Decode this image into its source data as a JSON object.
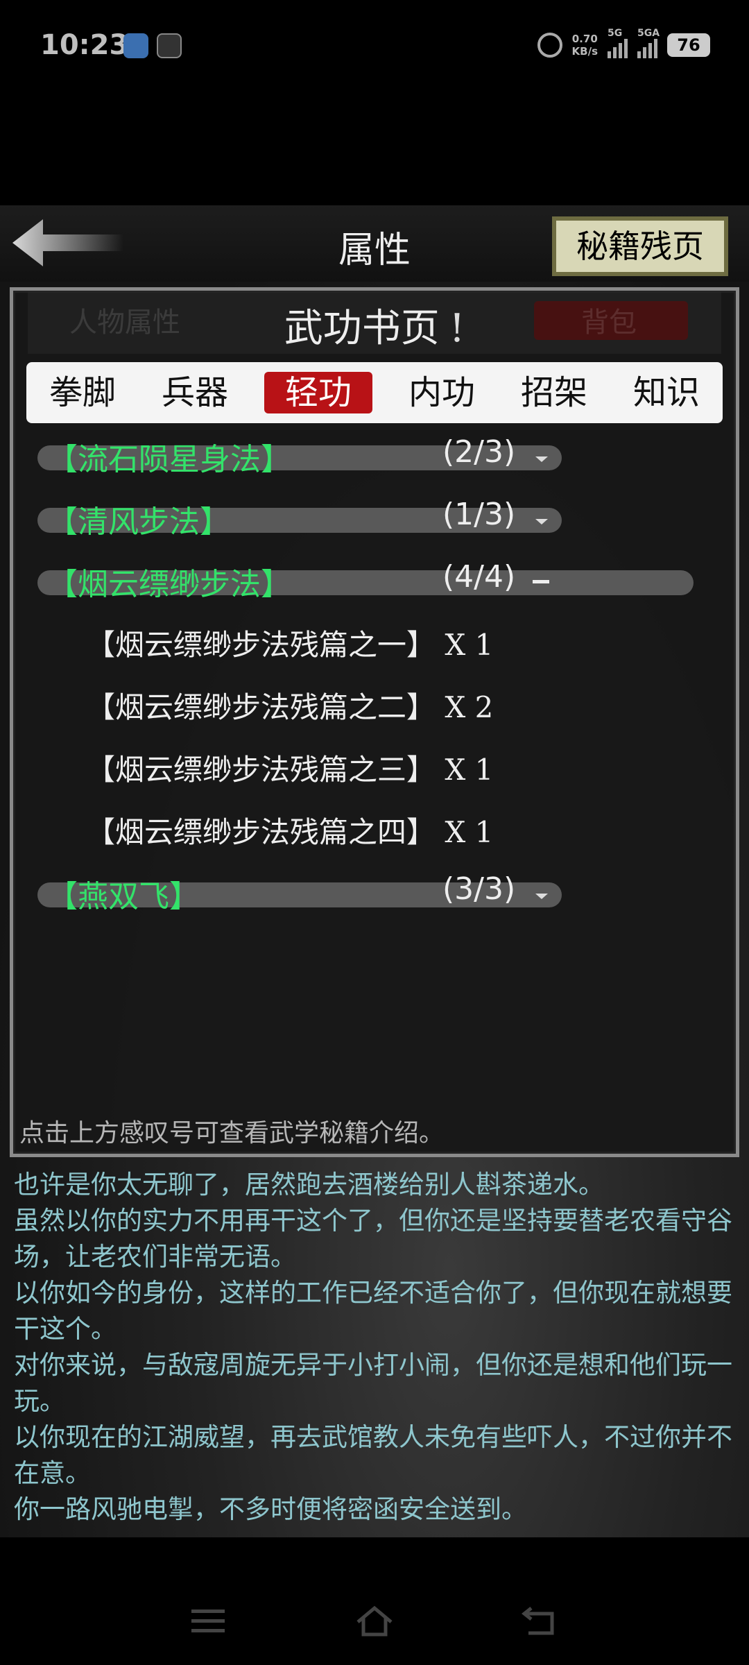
{
  "status_bar": {
    "time": "10:23",
    "net_speed_value": "0.70",
    "net_speed_unit": "KB/s",
    "signal1_label": "5G",
    "signal2_label": "5GA",
    "battery": "76"
  },
  "header": {
    "title": "属性",
    "secret_button": "秘籍残页"
  },
  "panel": {
    "title": "武功书页",
    "info_mark": "!",
    "ghost_left_tab": "人物属性",
    "ghost_right_tab": "背包",
    "tabs": [
      {
        "label": "拳脚",
        "active": false
      },
      {
        "label": "兵器",
        "active": false
      },
      {
        "label": "轻功",
        "active": true
      },
      {
        "label": "内功",
        "active": false
      },
      {
        "label": "招架",
        "active": false
      },
      {
        "label": "知识",
        "active": false
      }
    ],
    "skills": [
      {
        "name": "【流石陨星身法】",
        "progress": "(2/3)",
        "expanded": false
      },
      {
        "name": "【清风步法】",
        "progress": "(1/3)",
        "expanded": false
      },
      {
        "name": "【烟云缥缈步法】",
        "progress": "(4/4)",
        "expanded": true
      },
      {
        "name": "【燕双飞】",
        "progress": "(3/3)",
        "expanded": false
      }
    ],
    "pages": [
      "【烟云缥缈步法残篇之一】 X 1",
      "【烟云缥缈步法残篇之二】 X 2",
      "【烟云缥缈步法残篇之三】 X 1",
      "【烟云缥缈步法残篇之四】 X 1"
    ],
    "hint": "点击上方感叹号可查看武学秘籍介绍。"
  },
  "log": [
    "也许是你太无聊了，居然跑去酒楼给别人斟茶递水。",
    "虽然以你的实力不用再干这个了，但你还是坚持要替老农看守谷场，让老农们非常无语。",
    "以你如今的身份，这样的工作已经不适合你了，但你现在就想要干这个。",
    "对你来说，与敌寇周旋无异于小打小闹，但你还是想和他们玩一玩。",
    "以你现在的江湖威望，再去武馆教人未免有些吓人，不过你并不在意。",
    "你一路风驰电掣，不多时便将密函安全送到。"
  ],
  "colors": {
    "skill_name": "#33e36a",
    "active_tab": "#b81216",
    "log_text": "#8ec6cd"
  },
  "icons": {
    "back": "back-arrow-icon",
    "alarm": "alarm-icon",
    "nav_menu": "menu-icon",
    "nav_home": "home-icon",
    "nav_back": "back-icon"
  }
}
